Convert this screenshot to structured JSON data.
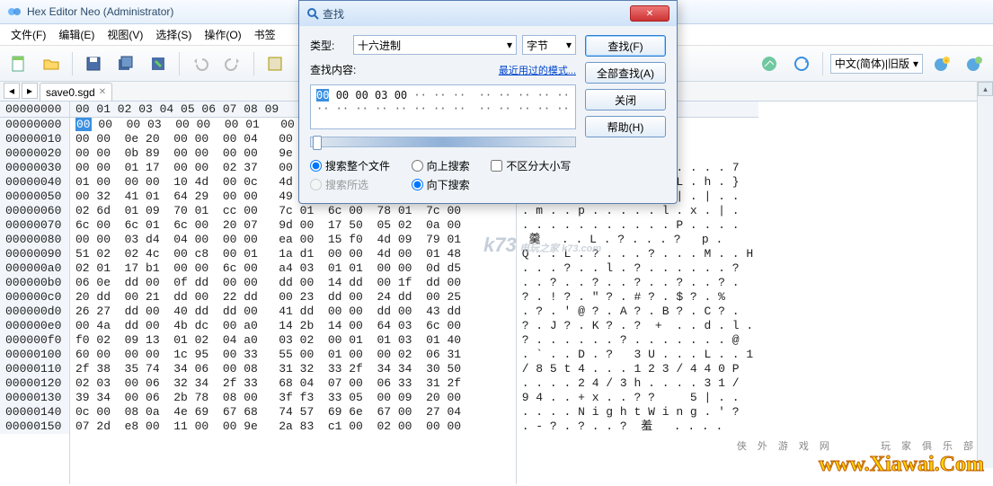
{
  "window": {
    "title": "Hex Editor Neo (Administrator)"
  },
  "menu": [
    "文件(F)",
    "编辑(E)",
    "视图(V)",
    "选择(S)",
    "操作(O)",
    "书签"
  ],
  "lang_select": "中文(简体)|旧版",
  "tab": {
    "name": "save0.sgd"
  },
  "addr_header": "00000000",
  "hex_header": "00 01  02 03  04 05  06 07   08 09",
  "rows": [
    {
      "addr": "00000000",
      "hex": "00 00  00 03  00 00  00 01   00 00",
      "asc": ""
    },
    {
      "addr": "00000010",
      "hex": "00 00  0e 20  00 00  00 04   00 00",
      "asc": ""
    },
    {
      "addr": "00000020",
      "hex": "00 00  0b 89  00 00  00 00   9e 2a",
      "asc": ""
    },
    {
      "addr": "00000030",
      "hex": "00 00  01 17  00 00  02 37   00 00  01 17  00 00  02 37",
      "asc": ". . . . . . . 7 . . . . . . . 7"
    },
    {
      "addr": "00000040",
      "hex": "01 00  00 00  10 4d  00 0c   4d 00  01 4c  00 4c  00 68  00 7d",
      "asc": ". . . . . M . . M . . L . h . }"
    },
    {
      "addr": "00000050",
      "hex": "00 32  41 01  64 29  00 00   49 01  00 7c  02 7c  00 7c",
      "asc": ". 2 A . d ) . . I . . | . | . ."
    },
    {
      "addr": "00000060",
      "hex": "02 6d  01 09  70 01  cc 00   7c 01  6c 00  78 01  7c 00",
      "asc": ". m . . p . . . . . l . x . | ."
    },
    {
      "addr": "00000070",
      "hex": "6c 00  6c 01  6c 00  20 07   9d 00  17 50  05 02  0a 00",
      "asc": ". . . . . . . . . . . P . . . ."
    },
    {
      "addr": "00000080",
      "hex": "00 00  03 d4  04 00  00 00   ea 00  15 f0  4d 09  79 01",
      "asc": " 羹   . . L . ? . . . ?   p ."
    },
    {
      "addr": "00000090",
      "hex": "51 02  02 4c  00 c8  00 01   1a d1  00 00  4d 00  01 48",
      "asc": "Q . . L . ? . . . ? . . . M . . H"
    },
    {
      "addr": "000000a0",
      "hex": "02 01  17 b1  00 00  6c 00   a4 03  01 01  00 00  0d d5",
      "asc": ". . . ? . . l . ? . . . . . . ?"
    },
    {
      "addr": "000000b0",
      "hex": "06 0e  dd 00  0f dd  00 00   dd 00  14 dd  00 1f  dd 00",
      "asc": ". . ? . . ? . . ? . . ? . . ? ."
    },
    {
      "addr": "000000c0",
      "hex": "20 dd  00 21  dd 00  22 dd   00 23  dd 00  24 dd  00 25",
      "asc": "? . ! ? . \" ? . # ? . $ ? . %"
    },
    {
      "addr": "000000d0",
      "hex": "26 27  dd 00  40 dd  dd 00   41 dd  00 00  dd 00  43 dd",
      "asc": ". ? . ' @ ? . A ? . B ? . C ? ."
    },
    {
      "addr": "000000e0",
      "hex": "00 4a  dd 00  4b dc  00 a0   14 2b  14 00  64 03  6c 00",
      "asc": "? . J ? . K ? . ?  +  . . d . l ."
    },
    {
      "addr": "000000f0",
      "hex": "f0 02  09 13  01 02  04 a0   03 02  00 01  01 03  01 40",
      "asc": "? . . . . . . ? . . . . . . . @"
    },
    {
      "addr": "00000100",
      "hex": "60 00  00 00  1c 95  00 33   55 00  01 00  00 02  06 31",
      "asc": ". ` . . D . ?   3 U . . . L . . 1"
    },
    {
      "addr": "00000110",
      "hex": "2f 38  35 74  34 06  00 08   31 32  33 2f  34 34  30 50",
      "asc": "/ 8 5 t 4 . . . 1 2 3 / 4 4 0 P"
    },
    {
      "addr": "00000120",
      "hex": "02 03  00 06  32 34  2f 33   68 04  07 00  06 33  31 2f",
      "asc": ". . . . 2 4 / 3 h . . . . 3 1 /"
    },
    {
      "addr": "00000130",
      "hex": "39 34  00 06  2b 78  08 00   3f f3  33 05  00 09  20 00",
      "asc": "9 4 . . + x . . ? ?     5 | . ."
    },
    {
      "addr": "00000140",
      "hex": "0c 00  08 0a  4e 69  67 68   74 57  69 6e  67 00  27 04",
      "asc": ". . . . N i g h t W i n g . ' ?"
    },
    {
      "addr": "00000150",
      "hex": "07 2d  e8 00  11 00  00 9e   2a 83  c1 00  02 00  00 00",
      "asc": ". - ? . ? . . ?  羞   . . . ."
    }
  ],
  "dialog": {
    "title": "查找",
    "type_label": "类型:",
    "type_value": "十六进制",
    "unit_value": "字节",
    "content_label": "查找内容:",
    "recent_link": "最近用过的模式...",
    "content_hex": "00 00 00 03 00",
    "opt_whole": "搜索整个文件",
    "opt_sel": "搜索所选",
    "opt_up": "向上搜索",
    "opt_down": "向下搜索",
    "opt_case": "不区分大小写",
    "btn_find": "查找(F)",
    "btn_findall": "全部查找(A)",
    "btn_close": "关闭",
    "btn_help": "帮助(H)"
  },
  "watermark": {
    "cn_left": "侠外游戏网",
    "cn_right": "玩家俱乐部",
    "url": "www.Xiawai.Com"
  },
  "k73": {
    "big": "k73",
    "small": "电玩之家\nk73.com"
  }
}
